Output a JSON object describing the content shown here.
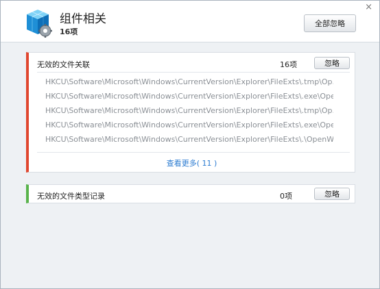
{
  "header": {
    "title": "组件相关",
    "count": "16项",
    "ignore_all": "全部忽略",
    "close": "×"
  },
  "sections": [
    {
      "title": "无效的文件关联",
      "count": "16项",
      "button": "忽略",
      "accent": "#e0462e",
      "rows": [
        "HKCU\\Software\\Microsoft\\Windows\\CurrentVersion\\Explorer\\FileExts\\.tmp\\Op...",
        "HKCU\\Software\\Microsoft\\Windows\\CurrentVersion\\Explorer\\FileExts\\.exe\\Ope...",
        "HKCU\\Software\\Microsoft\\Windows\\CurrentVersion\\Explorer\\FileExts\\.tmp\\Op...",
        "HKCU\\Software\\Microsoft\\Windows\\CurrentVersion\\Explorer\\FileExts\\.exe\\Ope...",
        "HKCU\\Software\\Microsoft\\Windows\\CurrentVersion\\Explorer\\FileExts\\.\\OpenW..."
      ],
      "more": "查看更多( 11 )"
    },
    {
      "title": "无效的文件类型记录",
      "count": "0项",
      "button": "忽略",
      "accent": "#58b34b"
    }
  ],
  "icons": {
    "app": "component-cube-gear-icon"
  },
  "colors": {
    "link": "#2b7bd1",
    "panel_bg": "#eef1f4"
  }
}
